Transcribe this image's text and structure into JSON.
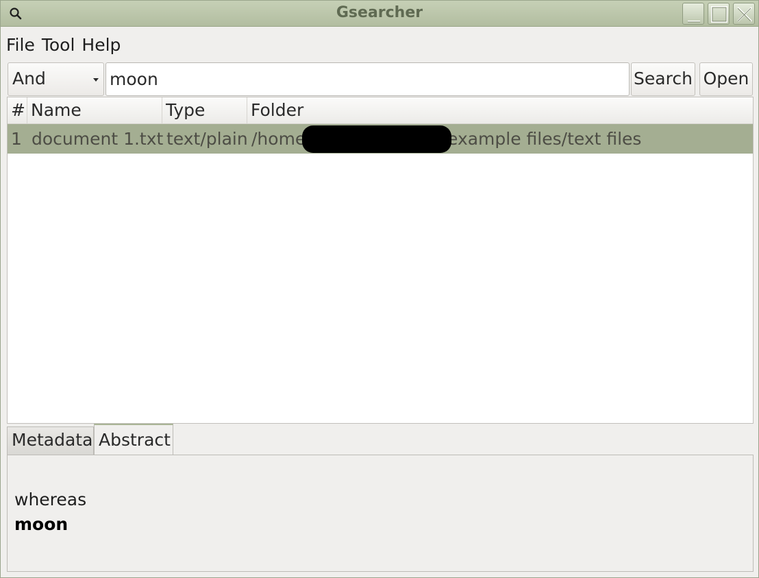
{
  "window": {
    "title": "Gsearcher"
  },
  "menubar": {
    "items": [
      {
        "label": "File"
      },
      {
        "label": "Tool"
      },
      {
        "label": "Help"
      }
    ]
  },
  "toolbar": {
    "operator_selected": "And",
    "search_value": "moon",
    "search_button": "Search",
    "open_button": "Open"
  },
  "results": {
    "columns": [
      "#",
      "Name",
      "Type",
      "Folder"
    ],
    "rows": [
      {
        "index": "1",
        "name": "document 1.txt",
        "type": "text/plain",
        "folder_prefix": "/home",
        "folder_suffix": "example files/text files"
      }
    ],
    "selected_row_color": "#a4ae92"
  },
  "tabs": [
    {
      "label": "Metadata",
      "active": false
    },
    {
      "label": "Abstract",
      "active": true
    }
  ],
  "abstract": {
    "lines": [
      "whereas",
      "moon"
    ]
  },
  "colors": {
    "titlebar": "#b8c3a6",
    "accent": "#aab596"
  }
}
